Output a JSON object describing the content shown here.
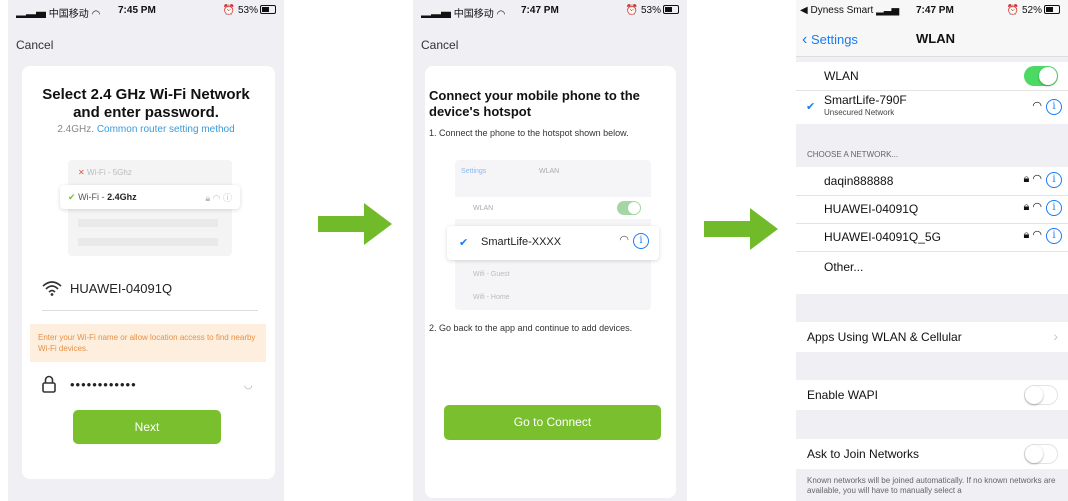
{
  "phone1": {
    "status": {
      "carrier": "中国移动",
      "time": "7:45 PM",
      "battery": "53%"
    },
    "cancel": "Cancel",
    "title_line1": "Select 2.4 GHz Wi-Fi Network",
    "title_line2": "and enter password.",
    "subtitle_prefix": "2.4GHz.",
    "subtitle_link": "Common router setting method",
    "mini_rows": {
      "row1": "Wi-Fi - 5Ghz",
      "row2_prefix": "Wi-Fi - ",
      "row2_bold": "2.4Ghz"
    },
    "ssid": "HUAWEI-04091Q",
    "notice": "Enter your Wi-Fi name or allow location access to find nearby Wi-Fi devices.",
    "password_mask": "••••••••••••",
    "next": "Next"
  },
  "phone2": {
    "status": {
      "carrier": "中国移动",
      "time": "7:47 PM",
      "battery": "53%"
    },
    "cancel": "Cancel",
    "title": "Connect your mobile phone to the device's hotspot",
    "step1": "1. Connect the phone to the hotspot shown below.",
    "mini": {
      "back": "Settings",
      "title": "WLAN",
      "wlan": "WLAN",
      "selected": "SmartLife-XXXX",
      "guest": "Wifi - Guest",
      "home": "Wifi - Home"
    },
    "step2": "2. Go back to the app and continue to add devices.",
    "connect": "Go to Connect"
  },
  "phone3": {
    "status": {
      "carrier": "Dyness Smart",
      "time": "7:47 PM",
      "battery": "52%"
    },
    "nav": {
      "back": "Settings",
      "title": "WLAN"
    },
    "wlan_label": "WLAN",
    "connected": {
      "name": "SmartLife-790F",
      "sub": "Unsecured Network"
    },
    "choose_header": "CHOOSE A NETWORK...",
    "networks": [
      "daqin888888",
      "HUAWEI-04091Q",
      "HUAWEI-04091Q_5G"
    ],
    "other": "Other...",
    "apps": "Apps Using WLAN & Cellular",
    "wapi": "Enable WAPI",
    "ask": "Ask to Join Networks",
    "footer": "Known networks will be joined automatically. If no known networks are available, you will have to manually select a"
  },
  "colors": {
    "green": "#79bf2e",
    "ios_blue": "#1a7cf5",
    "ios_green": "#4cd964",
    "arrow": "#71bb2a"
  },
  "icons": [
    "signal-icon",
    "wifi-icon",
    "alarm-icon",
    "battery-icon",
    "check-icon",
    "lock-icon",
    "info-icon",
    "eye-icon",
    "chevron-right-icon",
    "arrow-right-icon"
  ]
}
